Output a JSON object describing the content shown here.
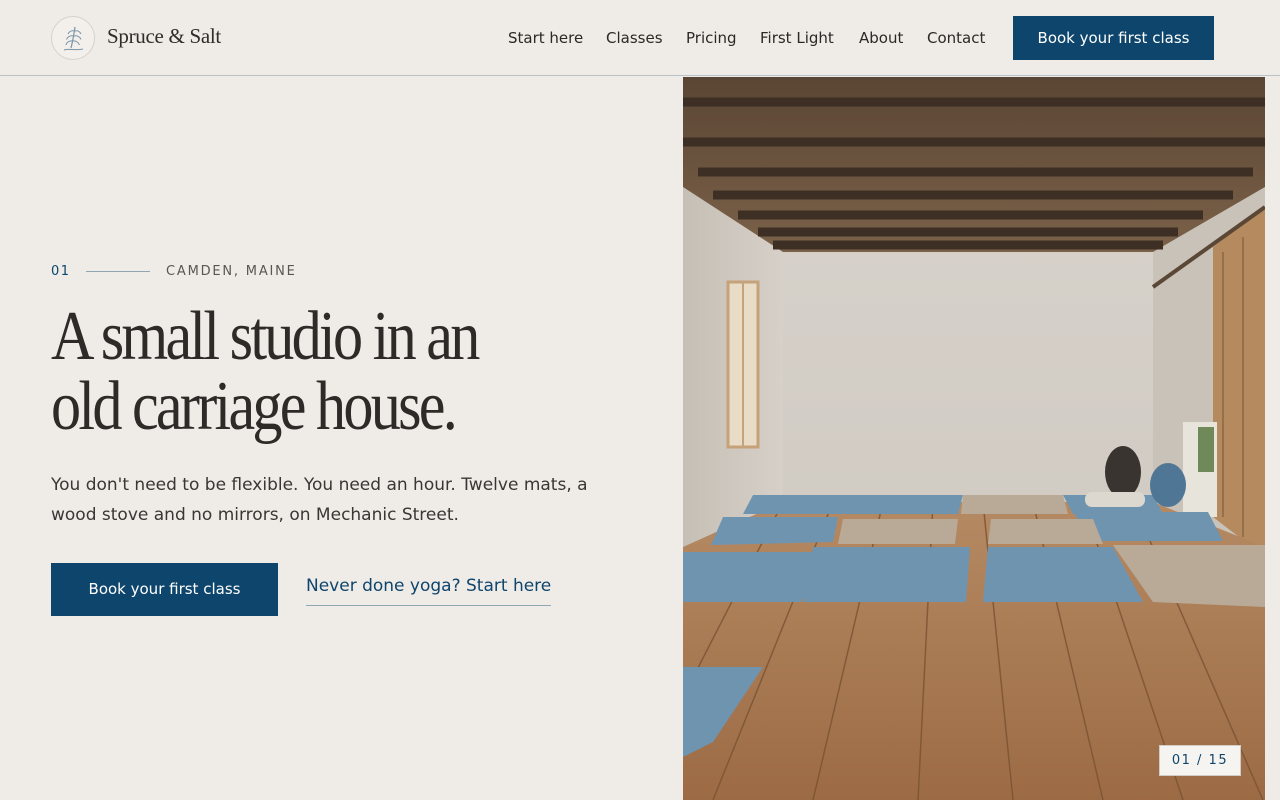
{
  "brand": {
    "name": "Spruce & Salt",
    "logo_icon": "fern-icon"
  },
  "nav": {
    "items": [
      {
        "label": "Start here"
      },
      {
        "label": "Classes"
      },
      {
        "label": "Pricing"
      },
      {
        "label": "First Light"
      },
      {
        "label": "About"
      },
      {
        "label": "Contact"
      }
    ],
    "cta_label": "Book your first class"
  },
  "hero": {
    "index": "01",
    "location": "CAMDEN, MAINE",
    "headline_line1": "A small studio in an",
    "headline_line2": "old carriage house.",
    "lede": "You don't need to be flexible. You need an hour. Twelve mats, a wood stove and no mirrors, on Mechanic Street.",
    "primary_cta": "Book your first class",
    "secondary_cta": "Never done yoga? Start here"
  },
  "gallery": {
    "counter": "01 / 15"
  },
  "colors": {
    "accent": "#0d456c",
    "background": "#efebe7",
    "text": "#2b2826"
  }
}
